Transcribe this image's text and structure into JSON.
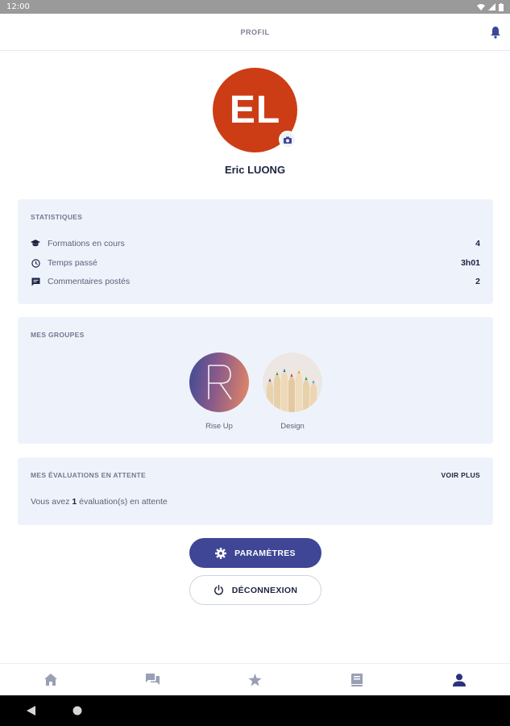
{
  "status_bar": {
    "time": "12:00"
  },
  "header": {
    "title": "PROFIL"
  },
  "profile": {
    "initials": "EL",
    "name": "Eric LUONG",
    "avatar_color": "#cc3d16"
  },
  "statistics": {
    "title": "STATISTIQUES",
    "rows": [
      {
        "label": "Formations en cours",
        "value": "4",
        "icon": "graduation-cap-icon"
      },
      {
        "label": "Temps passé",
        "value": "3h01",
        "icon": "clock-icon"
      },
      {
        "label": "Commentaires postés",
        "value": "2",
        "icon": "comment-icon"
      }
    ]
  },
  "groups": {
    "title": "MES GROUPES",
    "items": [
      {
        "name": "Rise Up",
        "letter": "R"
      },
      {
        "name": "Design"
      }
    ]
  },
  "evaluations": {
    "title": "MES ÉVALUATIONS EN ATTENTE",
    "see_more": "VOIR PLUS",
    "text_before": "Vous avez ",
    "count": "1",
    "text_after": " évaluation(s) en attente"
  },
  "buttons": {
    "settings": "PARAMÈTRES",
    "logout": "DÉCONNEXION"
  },
  "bottom_nav": [
    "home-icon",
    "chat-icon",
    "star-icon",
    "book-icon",
    "person-icon"
  ],
  "colors": {
    "accent": "#3e4695",
    "card_bg": "#eef3fb",
    "text_dark": "#1c2340"
  }
}
